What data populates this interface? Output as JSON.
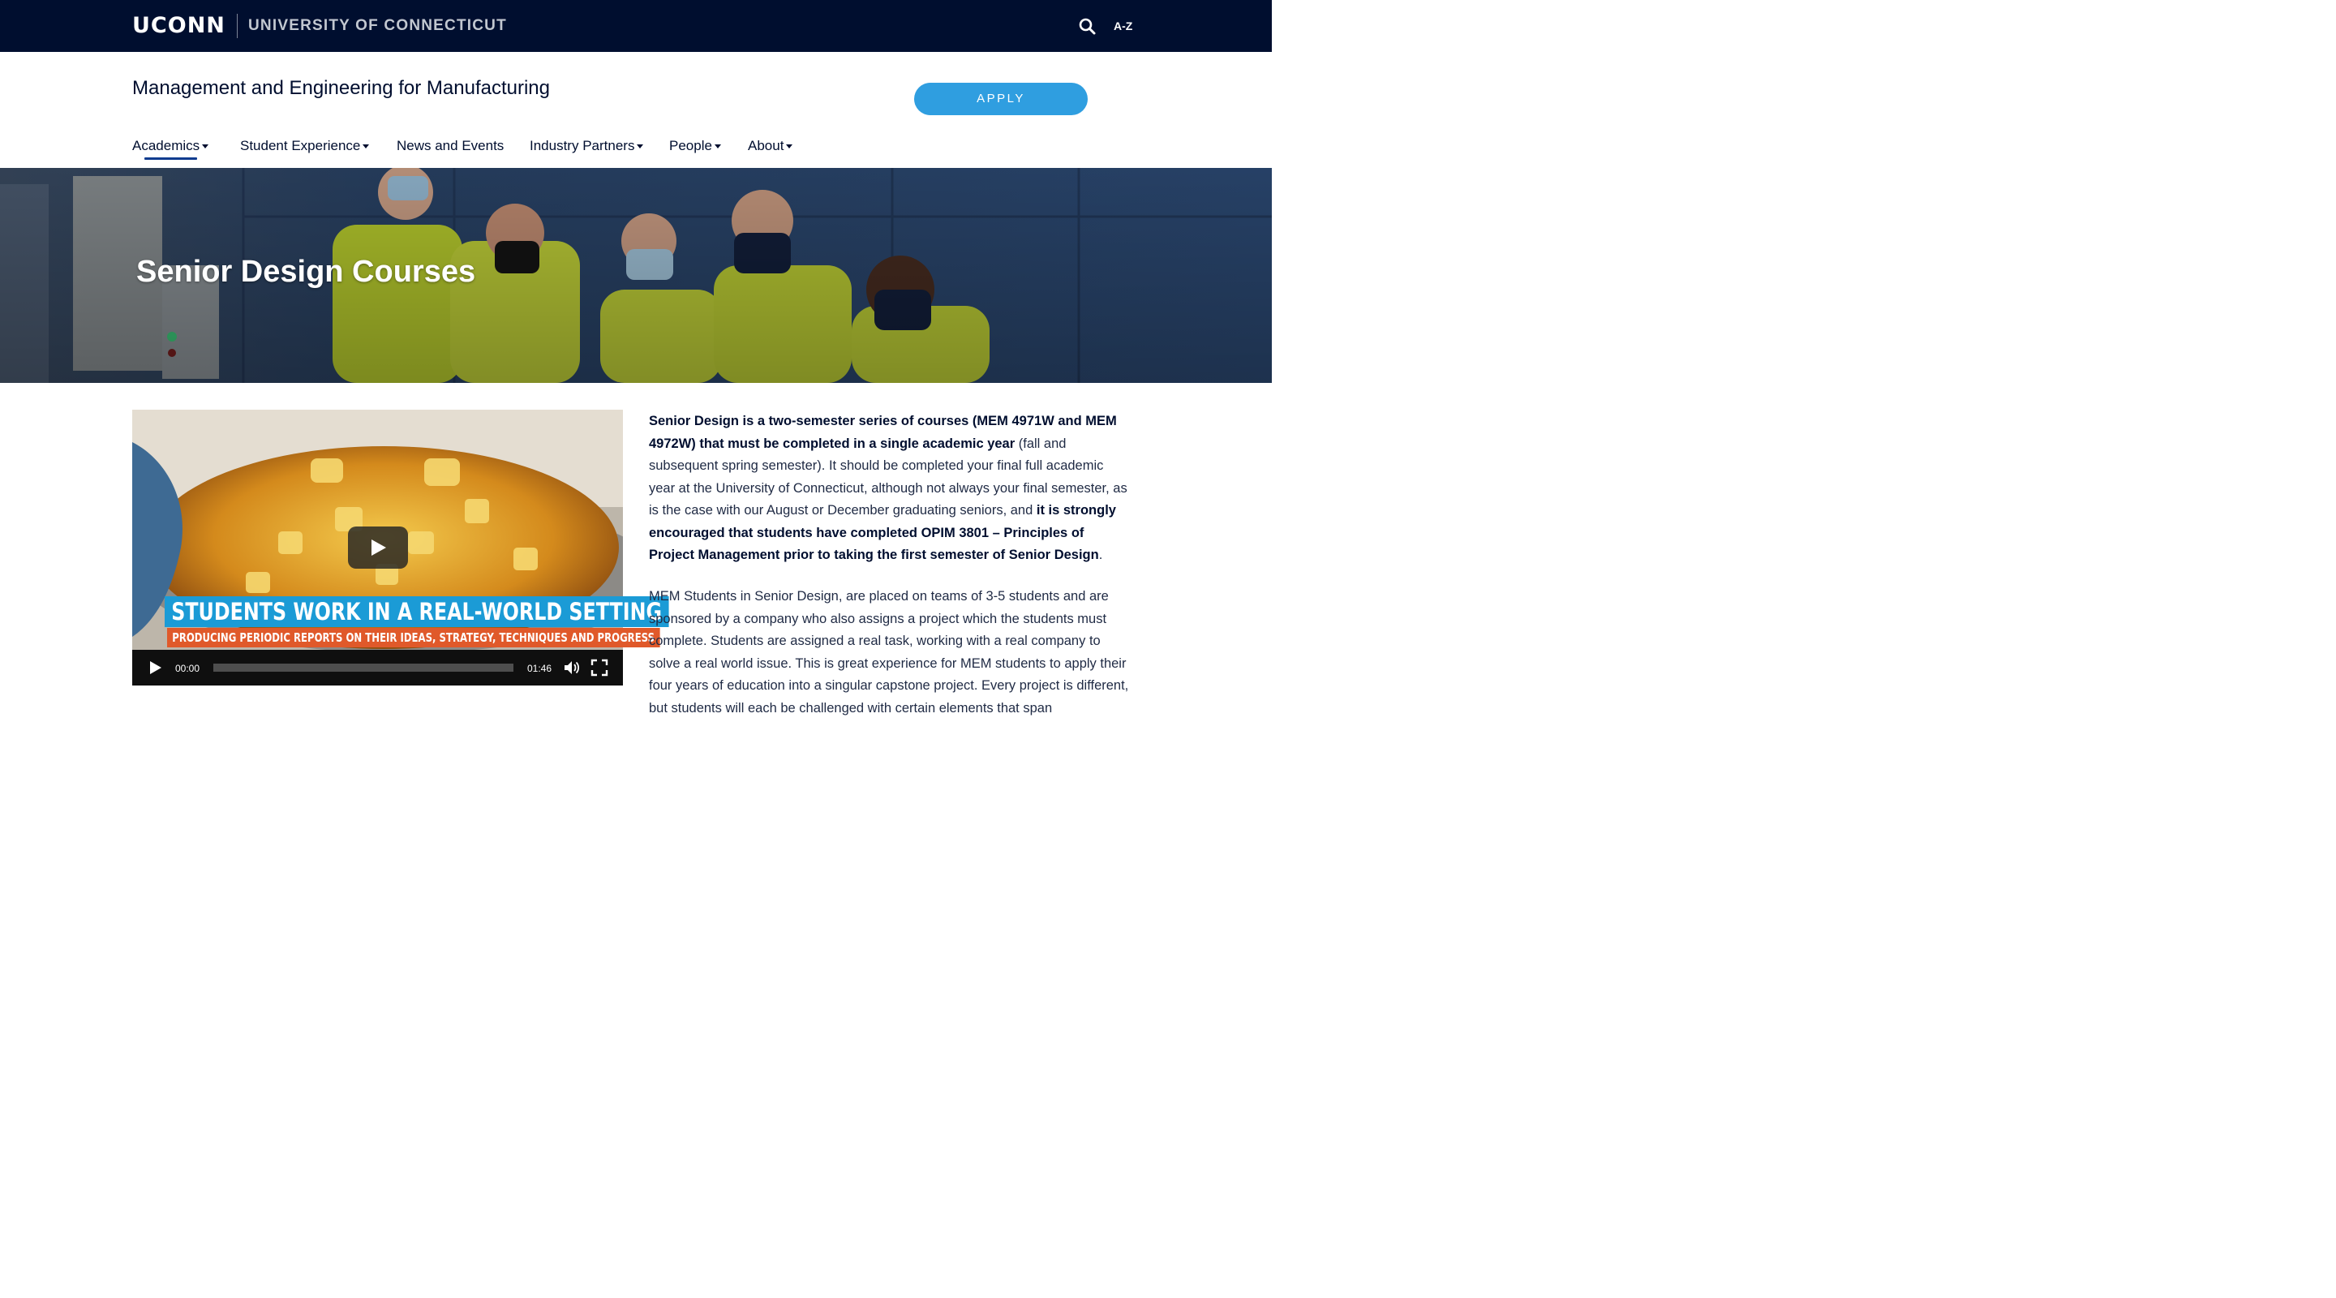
{
  "topbar": {
    "logo": "UCONN",
    "university": "UNIVERSITY OF CONNECTICUT",
    "az_label": "A-Z",
    "search_icon": "search-icon"
  },
  "header": {
    "site_title": "Management and Engineering for Manufacturing",
    "apply_label": "APPLY"
  },
  "nav": {
    "items": [
      {
        "label": "Academics",
        "has_dropdown": true,
        "active": true
      },
      {
        "label": "Student Experience",
        "has_dropdown": true
      },
      {
        "label": "News and Events",
        "has_dropdown": false
      },
      {
        "label": "Industry Partners",
        "has_dropdown": true
      },
      {
        "label": "People",
        "has_dropdown": true
      },
      {
        "label": "About",
        "has_dropdown": true
      }
    ]
  },
  "hero": {
    "title": "Senior Design Courses"
  },
  "video": {
    "caption_main": "STUDENTS WORK IN A REAL-WORLD SETTING",
    "caption_sub": "PRODUCING PERIODIC REPORTS ON THEIR IDEAS, STRATEGY, TECHNIQUES AND PROGRESS",
    "current_time": "00:00",
    "duration": "01:46",
    "progress": 0
  },
  "content": {
    "p1_bold1": "Senior Design is a two-semester series of courses (MEM 4971W and MEM 4972W) that must be completed in a single academic year",
    "p1_text1": " (fall and subsequent spring semester). It should be completed your final full academic year at the University of Connecticut, although not always your final semester, as is the case with our August or December graduating seniors, and ",
    "p1_bold2": "it is strongly encouraged that students have completed OPIM 3801 – Principles of Project Management prior to taking the first semester of Senior Design",
    "p1_end": ".",
    "p2": "MEM Students in Senior Design, are placed on teams of 3-5 students and are sponsored by a company who also assigns a project which the students must complete. Students are assigned a real task, working with a real company to solve a real world issue. This is great experience for MEM students to apply their four years of education into a singular capstone project. Every project is different, but students will each be challenged with certain elements that span"
  },
  "colors": {
    "navy": "#000e2f",
    "apply_blue": "#2f9ee0",
    "caption_blue": "#1b9bd6",
    "caption_orange": "#e0592a"
  }
}
